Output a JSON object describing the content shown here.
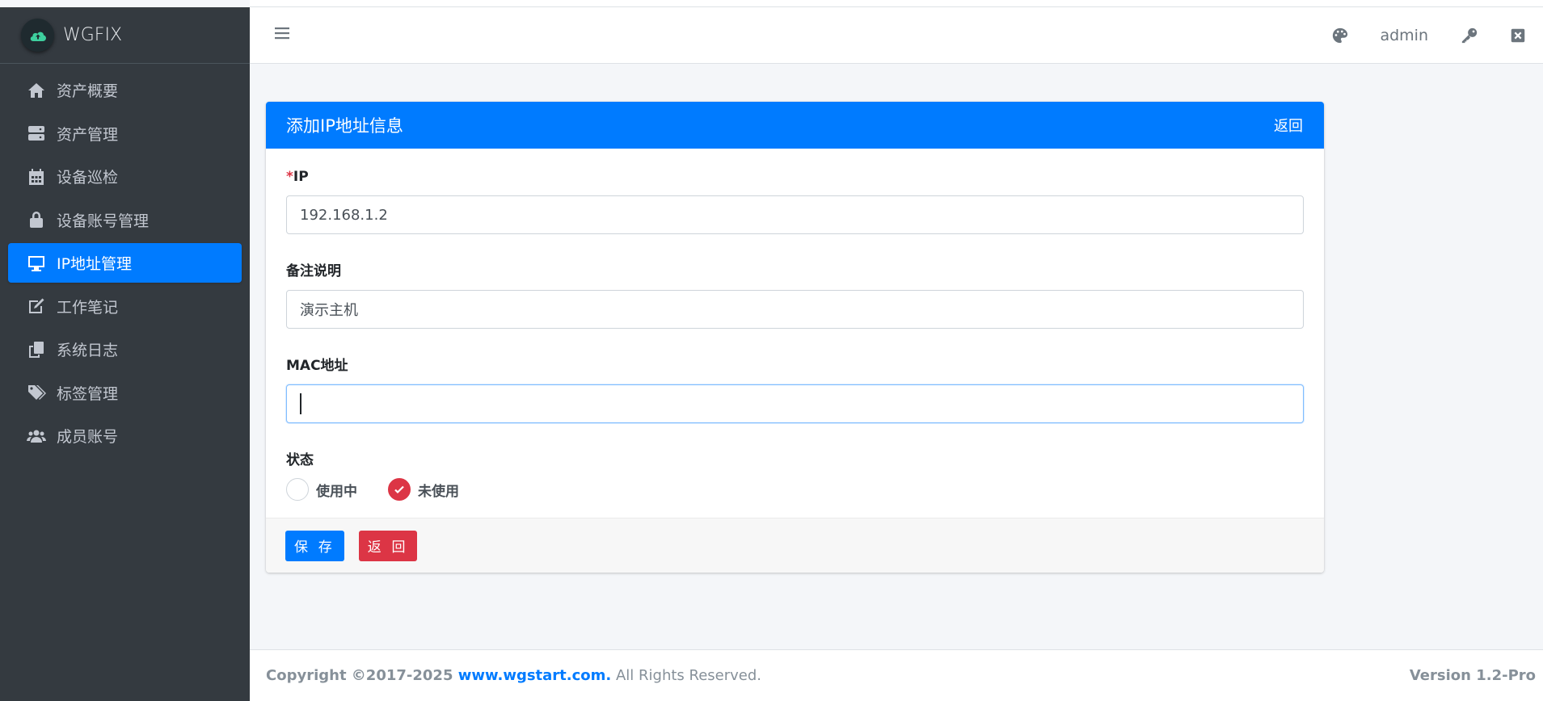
{
  "brand": {
    "name": "WGFIX"
  },
  "sidebar": {
    "items": [
      {
        "label": "资产概要",
        "icon": "home-icon"
      },
      {
        "label": "资产管理",
        "icon": "server-icon"
      },
      {
        "label": "设备巡检",
        "icon": "calendar-icon"
      },
      {
        "label": "设备账号管理",
        "icon": "lock-icon"
      },
      {
        "label": "IP地址管理",
        "icon": "desktop-icon",
        "active": true
      },
      {
        "label": "工作笔记",
        "icon": "edit-icon"
      },
      {
        "label": "系统日志",
        "icon": "copy-icon"
      },
      {
        "label": "标签管理",
        "icon": "tags-icon"
      },
      {
        "label": "成员账号",
        "icon": "users-icon"
      }
    ]
  },
  "topbar": {
    "user": "admin"
  },
  "card": {
    "title": "添加IP地址信息",
    "back_link": "返回"
  },
  "form": {
    "ip": {
      "required_mark": "*",
      "label": "IP",
      "value": "192.168.1.2"
    },
    "remark": {
      "label": "备注说明",
      "value": "演示主机"
    },
    "mac": {
      "label": "MAC地址",
      "value": ""
    },
    "status": {
      "label": "状态",
      "options": [
        {
          "label": "使用中",
          "checked": false
        },
        {
          "label": "未使用",
          "checked": true
        }
      ]
    }
  },
  "buttons": {
    "save": "保 存",
    "back": "返 回"
  },
  "footer": {
    "copyright_prefix": "Copyright ©2017-2025 ",
    "link": "www.wgstart.com.",
    "suffix": " All Rights Reserved.",
    "version": "Version 1.2-Pro"
  },
  "colors": {
    "primary": "#007bff",
    "danger": "#dc3545",
    "sidebar_bg": "#343a40"
  }
}
